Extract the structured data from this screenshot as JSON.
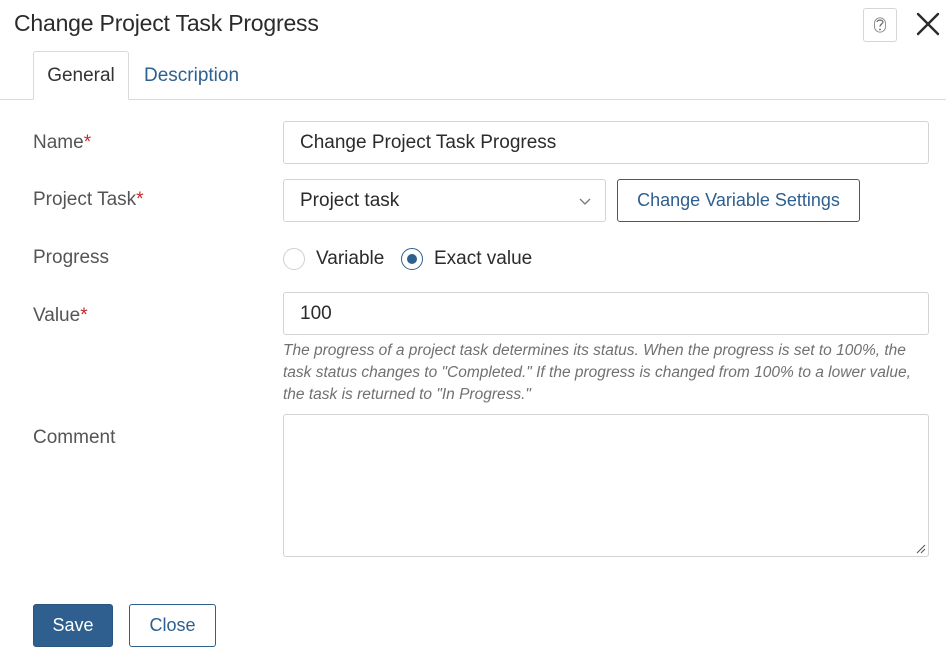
{
  "dialog": {
    "title": "Change Project Task Progress",
    "icons": {
      "help": "help-question-icon",
      "close": "close-x-icon"
    }
  },
  "tabs": [
    {
      "label": "General",
      "active": true
    },
    {
      "label": "Description",
      "active": false
    }
  ],
  "form": {
    "name": {
      "label": "Name",
      "required_mark": "*",
      "value": "Change Project Task Progress"
    },
    "project_task": {
      "label": "Project Task",
      "required_mark": "*",
      "selected": "Project task",
      "change_button": "Change Variable Settings"
    },
    "progress": {
      "label": "Progress",
      "options": [
        {
          "label": "Variable",
          "checked": false
        },
        {
          "label": "Exact value",
          "checked": true
        }
      ]
    },
    "value": {
      "label": "Value",
      "required_mark": "*",
      "value": "100",
      "hint": "The progress of a project task determines its status. When the progress is set to 100%, the task status changes to \"Completed.\" If the progress is changed from 100% to a lower value, the task is returned to \"In Progress.\""
    },
    "comment": {
      "label": "Comment",
      "value": ""
    }
  },
  "footer": {
    "save_label": "Save",
    "close_label": "Close"
  },
  "colors": {
    "accent": "#2d5f8f",
    "required": "#c62828"
  }
}
